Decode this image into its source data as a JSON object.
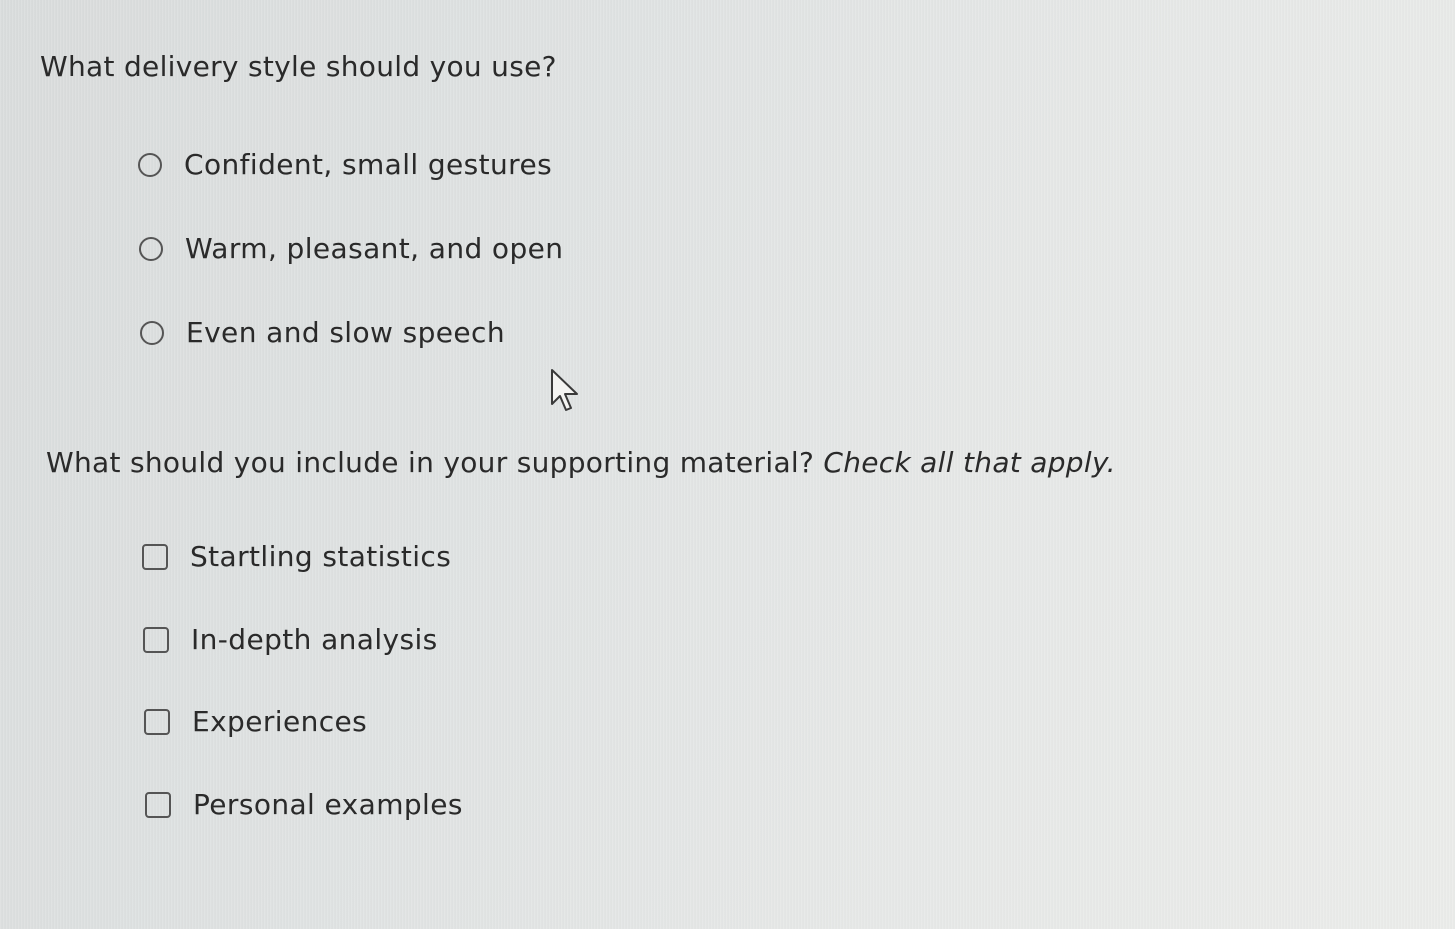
{
  "question1": {
    "text": "What delivery style should you use?",
    "options": [
      {
        "label": "Confident, small gestures",
        "selected": false
      },
      {
        "label": "Warm, pleasant, and open",
        "selected": false
      },
      {
        "label": "Even and slow speech",
        "selected": false
      }
    ]
  },
  "question2": {
    "text": "What should you include in your supporting material?",
    "hint": "Check all that apply.",
    "options": [
      {
        "label": "Startling statistics",
        "checked": false
      },
      {
        "label": "In-depth analysis",
        "checked": false
      },
      {
        "label": "Experiences",
        "checked": false
      },
      {
        "label": "Personal examples",
        "checked": false
      }
    ]
  },
  "icons": {
    "radio": "radio-button-empty",
    "checkbox": "checkbox-empty",
    "cursor": "mouse-pointer-arrow"
  }
}
